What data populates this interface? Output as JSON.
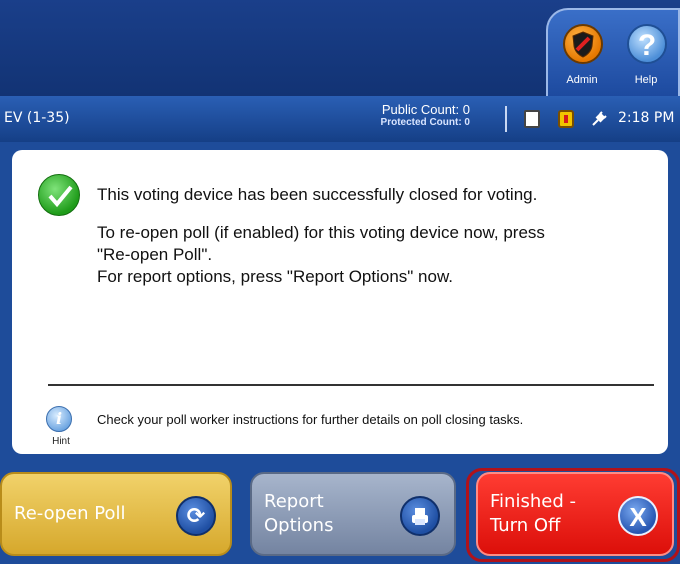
{
  "header": {
    "tabs": [
      {
        "label": "Admin",
        "icon": "shield-icon"
      },
      {
        "label": "Help",
        "icon": "question-icon"
      }
    ]
  },
  "status": {
    "ev": "EV (1-35)",
    "public_count": "Public Count: 0",
    "protected_count": "Protected Count: 0",
    "time": "2:18 PM",
    "icons": [
      "document-icon",
      "battery-icon",
      "power-plug-icon"
    ]
  },
  "content": {
    "success_message": "This voting device has been successfully closed for voting.",
    "reopen_message_1": "To re-open poll (if enabled) for this voting device now, press",
    "reopen_message_2": "\"Re-open Poll\".",
    "report_message": "For report options, press \"Report Options\" now.",
    "hint_label": "Hint",
    "hint_text": "Check your poll worker instructions for further details on poll closing tasks."
  },
  "buttons": {
    "reopen": "Re-open Poll",
    "report_line1": "Report",
    "report_line2": "Options",
    "finish_line1": "Finished -",
    "finish_line2": "Turn Off"
  },
  "colors": {
    "header_blue": "#123374",
    "content_blue": "#1e4c9a",
    "reopen_yellow": "#e6bd46",
    "report_gray": "#8d9bb7",
    "finish_red": "#e9231b",
    "success_green": "#1f9c1a"
  }
}
